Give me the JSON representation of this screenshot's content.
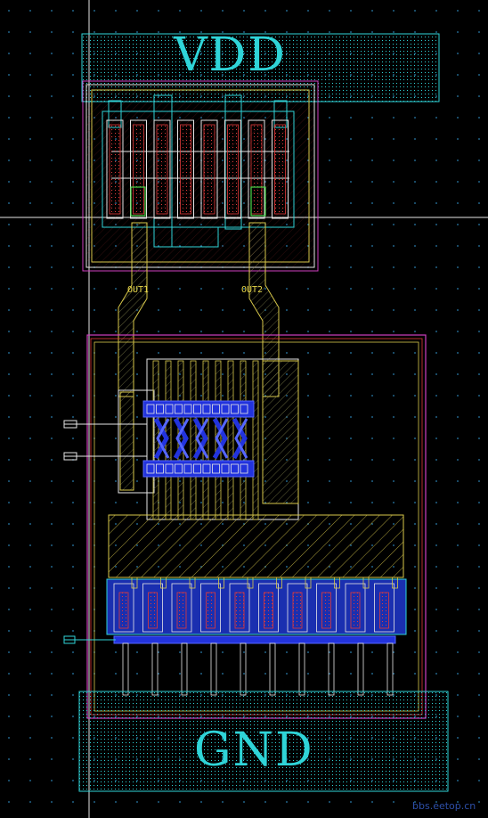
{
  "labels": {
    "vdd": "VDD",
    "gnd": "GND",
    "out1": "OUT1",
    "out2": "OUT2",
    "watermark": "bbs.eetop.cn"
  },
  "colors": {
    "background": "#000000",
    "grid": "#2a7fb0",
    "cyan": "#2fd4d8",
    "magenta": "#d040c0",
    "red": "#e03a3a",
    "yellow": "#d8c84a",
    "blue": "#2233dd",
    "white": "#e6e6e6",
    "green": "#4ad84a"
  }
}
